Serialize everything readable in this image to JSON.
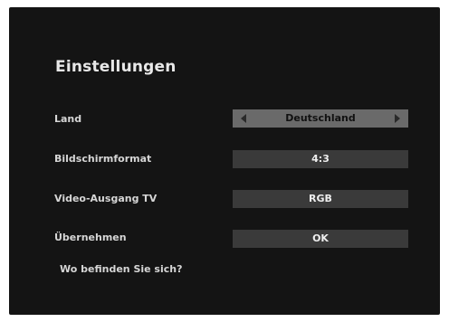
{
  "page": {
    "title": "Einstellungen"
  },
  "settings": [
    {
      "label": "Land",
      "value": "Deutschland"
    },
    {
      "label": "Bildschirmformat",
      "value": "4:3"
    },
    {
      "label": "Video-Ausgang TV",
      "value": "RGB"
    },
    {
      "label": "Übernehmen",
      "value": "OK"
    }
  ],
  "help": {
    "text": "Wo befinden Sie sich?"
  },
  "colors": {
    "background": "#141414",
    "selected_field": "#6a6a6a",
    "field": "#3a3a3a",
    "text": "#d6d6d6"
  },
  "icons": {
    "left": "triangle-left",
    "right": "triangle-right"
  }
}
